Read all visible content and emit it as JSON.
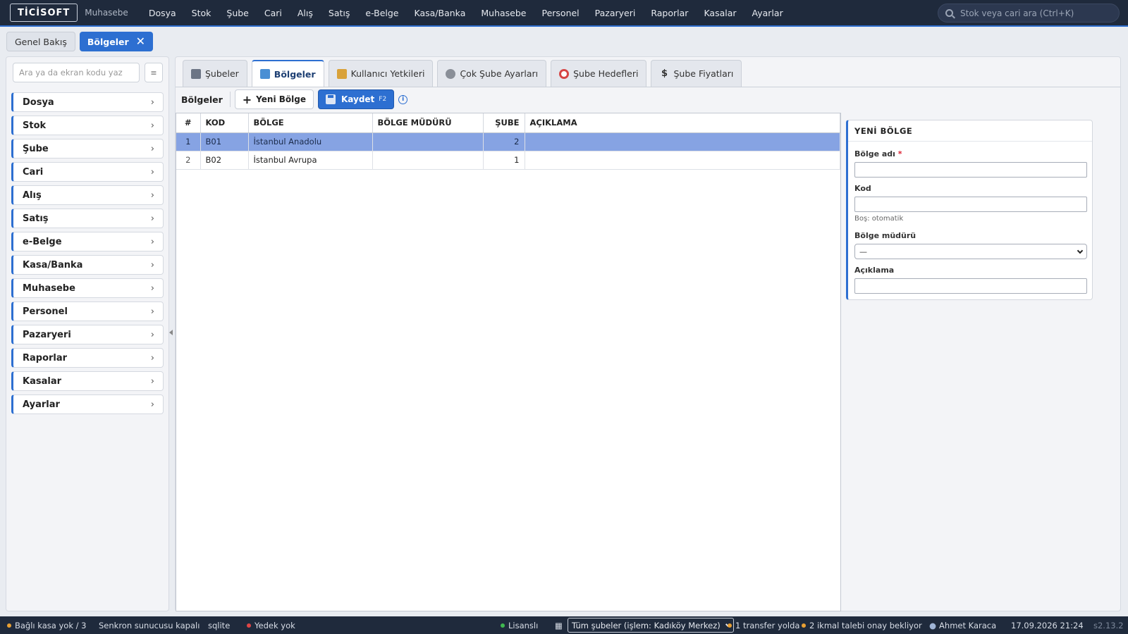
{
  "app": {
    "logo": "TİCİSOFT",
    "subtitle": "Muhasebe",
    "menu": [
      "Dosya",
      "Stok",
      "Şube",
      "Cari",
      "Alış",
      "Satış",
      "e-Belge",
      "Kasa/Banka",
      "Muhasebe",
      "Personel",
      "Pazaryeri",
      "Raporlar",
      "Kasalar",
      "Ayarlar"
    ],
    "search_placeholder": "Stok veya cari ara (Ctrl+K)"
  },
  "page_tabs": {
    "overview": "Genel Bakış",
    "active": "Bölgeler",
    "close": "✕"
  },
  "sidebar": {
    "search_placeholder": "Ara ya da ekran kodu yaz",
    "toggle_icon": "≡",
    "items": [
      "Dosya",
      "Stok",
      "Şube",
      "Cari",
      "Alış",
      "Satış",
      "e-Belge",
      "Kasa/Banka",
      "Muhasebe",
      "Personel",
      "Pazaryeri",
      "Raporlar",
      "Kasalar",
      "Ayarlar"
    ],
    "chevron": "›"
  },
  "subtabs": [
    {
      "label": "Şubeler",
      "icon": "building-icon",
      "color": "#6c7585"
    },
    {
      "label": "Bölgeler",
      "icon": "map-icon",
      "color": "#4a8fd4"
    },
    {
      "label": "Kullanıcı Yetkileri",
      "icon": "lock-icon",
      "color": "#d9a23a"
    },
    {
      "label": "Çok Şube Ayarları",
      "icon": "gear-icon",
      "color": "#8a8f98"
    },
    {
      "label": "Şube Hedefleri",
      "icon": "target-icon",
      "color": "#d64545"
    },
    {
      "label": "Şube Fiyatları",
      "icon": "dollar-icon",
      "color": "#333333"
    }
  ],
  "toolbar": {
    "title": "Bölgeler",
    "new_label": "Yeni Bölge",
    "new_icon": "+",
    "save_label": "Kaydet",
    "save_key": "F2",
    "info": "i"
  },
  "grid": {
    "columns": [
      "#",
      "KOD",
      "BÖLGE",
      "BÖLGE MÜDÜRÜ",
      "ŞUBE",
      "AÇIKLAMA"
    ],
    "rows": [
      {
        "no": "1",
        "kod": "B01",
        "bolge": "İstanbul Anadolu",
        "mudur": "",
        "sube": "2",
        "aciklama": ""
      },
      {
        "no": "2",
        "kod": "B02",
        "bolge": "İstanbul Avrupa",
        "mudur": "",
        "sube": "1",
        "aciklama": ""
      }
    ]
  },
  "form": {
    "title": "YENİ BÖLGE",
    "name_label": "Bölge adı",
    "required_mark": "*",
    "code_label": "Kod",
    "code_hint": "Boş: otomatik",
    "manager_label": "Bölge müdürü",
    "manager_value": "—",
    "desc_label": "Açıklama"
  },
  "status": {
    "cash": "Bağlı kasa yok / 3",
    "sync": "Senkron sunucusu kapalı",
    "db": "sqlite",
    "backup": "Yedek yok",
    "license": "Lisanslı",
    "branch_select": "Tüm şubeler (işlem: Kadıköy Merkez)",
    "transfer": "1 transfer yolda",
    "supply": "2 ikmal talebi onay bekliyor",
    "user": "Ahmet Karaca",
    "datetime": "17.09.2026 21:24",
    "version": "s2.13.2",
    "colors": {
      "warn": "#e8a033",
      "error": "#e04545",
      "ok": "#3fb950"
    }
  }
}
